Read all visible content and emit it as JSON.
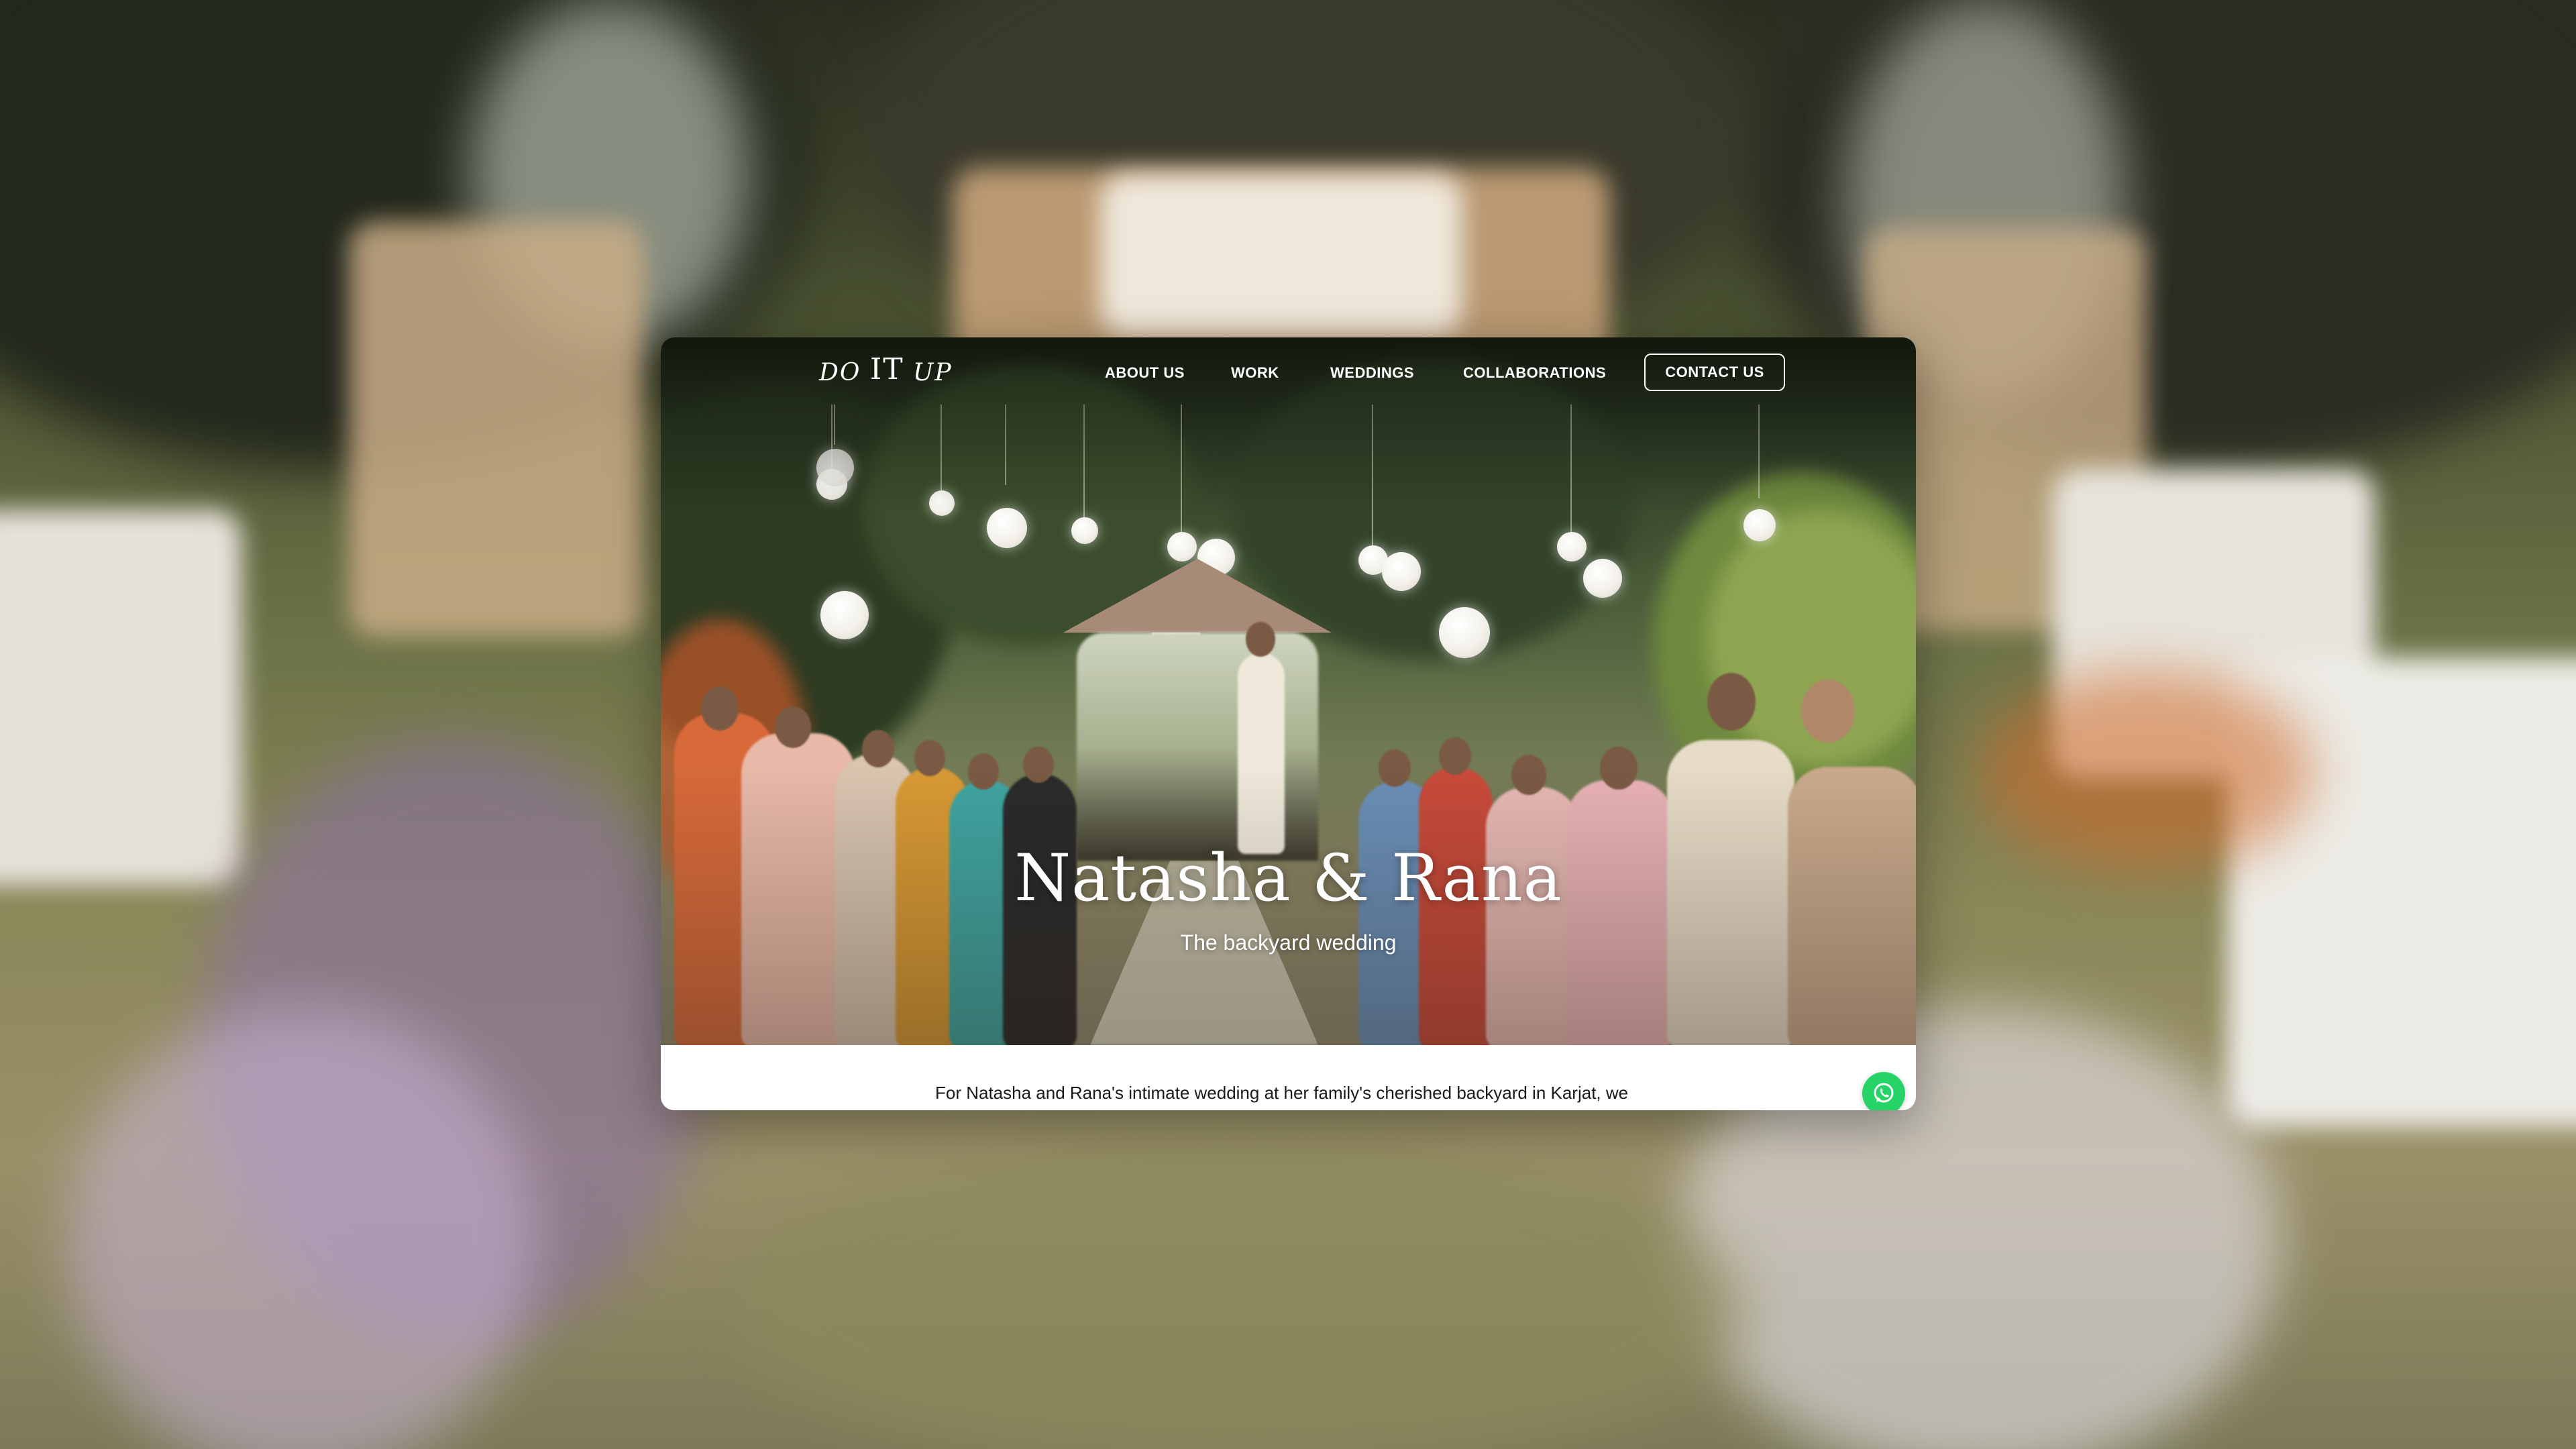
{
  "brand": {
    "logo_left": "DO",
    "logo_mid": "IT",
    "logo_right": "UP"
  },
  "nav": {
    "items": [
      {
        "label": "ABOUT US"
      },
      {
        "label": "WORK"
      },
      {
        "label": "WEDDINGS"
      },
      {
        "label": "COLLABORATIONS"
      }
    ],
    "contact_label": "CONTACT US"
  },
  "hero": {
    "title": "Natasha & Rana",
    "subtitle": "The backyard wedding"
  },
  "body": {
    "description": "For Natasha and Rana's intimate wedding at her family's cherished backyard in Karjat, we"
  },
  "colors": {
    "whatsapp": "#25d366",
    "text": "#1a1a1a",
    "nav_text": "#ffffff"
  },
  "icons": {
    "chat": "whatsapp-icon"
  }
}
